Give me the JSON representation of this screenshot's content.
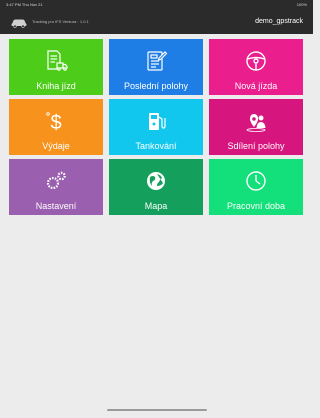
{
  "status_bar": {
    "time": "3:47 PM  Thu Nov 21",
    "right": "100%"
  },
  "header": {
    "subtitle": "Tracking pro IFS Ventura · 1.0.1",
    "username": "demo_gpstrack"
  },
  "colors": {
    "kniha_jizd": "#4dcc1a",
    "posledni_polohy": "#1f7ee6",
    "nova_jizda": "#ea1e8d",
    "vydaje": "#f7931c",
    "tankovani": "#12c7ee",
    "sdileni_polohy": "#d6167e",
    "nastaveni": "#9b5fb0",
    "mapa": "#14a05c",
    "pracovni_doba": "#13df7b",
    "header_bg": "#2b2b2b",
    "page_bg": "#ececec"
  },
  "tiles": [
    {
      "label": "Kniha jízd",
      "icon": "logbook-truck-icon"
    },
    {
      "label": "Poslední polohy",
      "icon": "last-positions-icon"
    },
    {
      "label": "Nová jízda",
      "icon": "steering-wheel-icon"
    },
    {
      "label": "Výdaje",
      "icon": "dollar-icon"
    },
    {
      "label": "Tankování",
      "icon": "fuel-pump-icon"
    },
    {
      "label": "Sdílení polohy",
      "icon": "share-location-icon"
    },
    {
      "label": "Nastavení",
      "icon": "gears-icon"
    },
    {
      "label": "Mapa",
      "icon": "globe-icon"
    },
    {
      "label": "Pracovní doba",
      "icon": "clock-icon"
    }
  ]
}
